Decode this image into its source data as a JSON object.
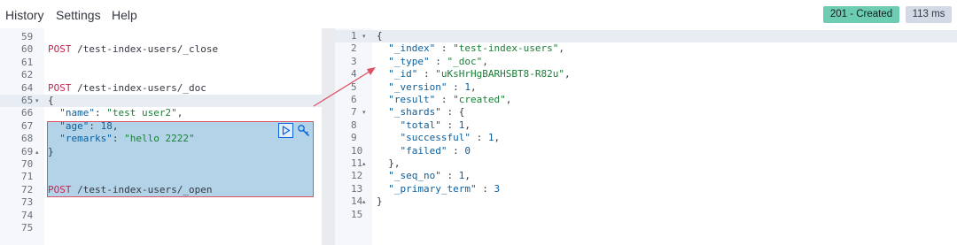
{
  "menu": [
    "History",
    "Settings",
    "Help"
  ],
  "status": {
    "label": "201 - Created",
    "time": "113 ms",
    "color": "#6dccb1"
  },
  "request_lines": [
    {
      "n": "59",
      "fold": "",
      "parts": []
    },
    {
      "n": "60",
      "fold": "",
      "parts": [
        [
          "kw",
          "POST"
        ],
        [
          "path",
          " /test-index-users/_close"
        ]
      ]
    },
    {
      "n": "61",
      "fold": "",
      "parts": []
    },
    {
      "n": "62",
      "fold": "",
      "parts": []
    },
    {
      "n": "64",
      "fold": "",
      "parts": [
        [
          "kw",
          "POST"
        ],
        [
          "path",
          " /test-index-users/_doc"
        ]
      ]
    },
    {
      "n": "65",
      "fold": "▾",
      "parts": [
        [
          "punc",
          "{"
        ]
      ]
    },
    {
      "n": "66",
      "fold": "",
      "parts": [
        [
          "punc",
          "  "
        ],
        [
          "key",
          "\"name\""
        ],
        [
          "punc",
          ": "
        ],
        [
          "str",
          "\"test user2\""
        ],
        [
          "punc",
          ","
        ]
      ]
    },
    {
      "n": "67",
      "fold": "",
      "parts": [
        [
          "punc",
          "  "
        ],
        [
          "key",
          "\"age\""
        ],
        [
          "punc",
          ": "
        ],
        [
          "num",
          "18"
        ],
        [
          "punc",
          ","
        ]
      ]
    },
    {
      "n": "68",
      "fold": "",
      "parts": [
        [
          "punc",
          "  "
        ],
        [
          "key",
          "\"remarks\""
        ],
        [
          "punc",
          ": "
        ],
        [
          "str",
          "\"hello 2222\""
        ]
      ]
    },
    {
      "n": "69",
      "fold": "▴",
      "parts": [
        [
          "punc",
          "}"
        ]
      ]
    },
    {
      "n": "70",
      "fold": "",
      "parts": []
    },
    {
      "n": "71",
      "fold": "",
      "parts": []
    },
    {
      "n": "72",
      "fold": "",
      "parts": [
        [
          "kw",
          "POST"
        ],
        [
          "path",
          " /test-index-users/_open"
        ]
      ]
    },
    {
      "n": "73",
      "fold": "",
      "parts": []
    },
    {
      "n": "74",
      "fold": "",
      "parts": []
    },
    {
      "n": "75",
      "fold": "",
      "parts": []
    }
  ],
  "response_lines": [
    {
      "n": "1",
      "fold": "▾",
      "parts": [
        [
          "punc",
          "{"
        ]
      ]
    },
    {
      "n": "2",
      "fold": "",
      "parts": [
        [
          "punc",
          "  "
        ],
        [
          "key",
          "\"_index\""
        ],
        [
          "punc",
          " : "
        ],
        [
          "str",
          "\"test-index-users\""
        ],
        [
          "punc",
          ","
        ]
      ]
    },
    {
      "n": "3",
      "fold": "",
      "parts": [
        [
          "punc",
          "  "
        ],
        [
          "key",
          "\"_type\""
        ],
        [
          "punc",
          " : "
        ],
        [
          "str",
          "\"_doc\""
        ],
        [
          "punc",
          ","
        ]
      ]
    },
    {
      "n": "4",
      "fold": "",
      "parts": [
        [
          "punc",
          "  "
        ],
        [
          "key",
          "\"_id\""
        ],
        [
          "punc",
          " : "
        ],
        [
          "str",
          "\"uKsHrHgBARHSBT8-R82u\""
        ],
        [
          "punc",
          ","
        ]
      ]
    },
    {
      "n": "5",
      "fold": "",
      "parts": [
        [
          "punc",
          "  "
        ],
        [
          "key",
          "\"_version\""
        ],
        [
          "punc",
          " : "
        ],
        [
          "num",
          "1"
        ],
        [
          "punc",
          ","
        ]
      ]
    },
    {
      "n": "6",
      "fold": "",
      "parts": [
        [
          "punc",
          "  "
        ],
        [
          "key",
          "\"result\""
        ],
        [
          "punc",
          " : "
        ],
        [
          "str",
          "\"created\""
        ],
        [
          "punc",
          ","
        ]
      ]
    },
    {
      "n": "7",
      "fold": "▾",
      "parts": [
        [
          "punc",
          "  "
        ],
        [
          "key",
          "\"_shards\""
        ],
        [
          "punc",
          " : {"
        ]
      ]
    },
    {
      "n": "8",
      "fold": "",
      "parts": [
        [
          "punc",
          "    "
        ],
        [
          "key",
          "\"total\""
        ],
        [
          "punc",
          " : "
        ],
        [
          "num",
          "1"
        ],
        [
          "punc",
          ","
        ]
      ]
    },
    {
      "n": "9",
      "fold": "",
      "parts": [
        [
          "punc",
          "    "
        ],
        [
          "key",
          "\"successful\""
        ],
        [
          "punc",
          " : "
        ],
        [
          "num",
          "1"
        ],
        [
          "punc",
          ","
        ]
      ]
    },
    {
      "n": "10",
      "fold": "",
      "parts": [
        [
          "punc",
          "    "
        ],
        [
          "key",
          "\"failed\""
        ],
        [
          "punc",
          " : "
        ],
        [
          "num",
          "0"
        ]
      ]
    },
    {
      "n": "11",
      "fold": "▴",
      "parts": [
        [
          "punc",
          "  },"
        ]
      ]
    },
    {
      "n": "12",
      "fold": "",
      "parts": [
        [
          "punc",
          "  "
        ],
        [
          "key",
          "\"_seq_no\""
        ],
        [
          "punc",
          " : "
        ],
        [
          "num",
          "1"
        ],
        [
          "punc",
          ","
        ]
      ]
    },
    {
      "n": "13",
      "fold": "",
      "parts": [
        [
          "punc",
          "  "
        ],
        [
          "key",
          "\"_primary_term\""
        ],
        [
          "punc",
          " : "
        ],
        [
          "num",
          "3"
        ]
      ]
    },
    {
      "n": "14",
      "fold": "▴",
      "parts": [
        [
          "punc",
          "}"
        ]
      ]
    },
    {
      "n": "15",
      "fold": "",
      "parts": []
    }
  ]
}
